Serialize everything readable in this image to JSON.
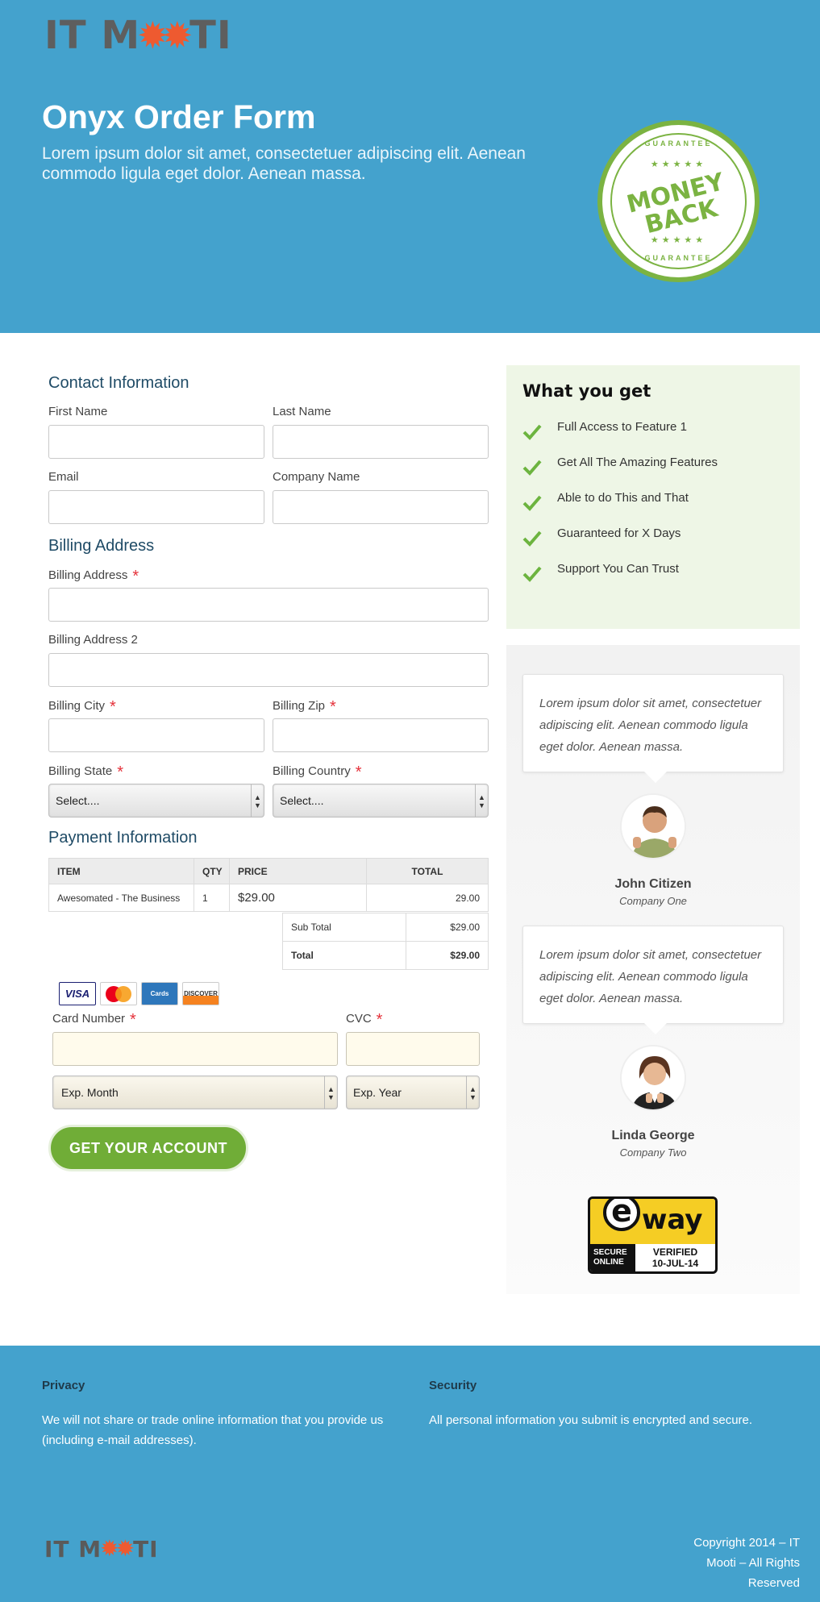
{
  "brand": {
    "logo_left": "IT M",
    "logo_right": "TI"
  },
  "hero": {
    "title": "Onyx Order Form",
    "lead": "Lorem ipsum dolor sit amet, consectetuer adipiscing elit. Aenean commodo ligula eget dolor. Aenean massa.",
    "seal": {
      "ring_top": "GUARANTEE",
      "ring_bottom": "GUARANTEE",
      "line1": "MONEY",
      "line2": "BACK",
      "stars": "★★★★★"
    }
  },
  "contact": {
    "title": "Contact Information",
    "first_name": "First Name",
    "last_name": "Last Name",
    "email": "Email",
    "company": "Company Name"
  },
  "billing": {
    "title": "Billing Address",
    "address": "Billing Address",
    "address2": "Billing Address 2",
    "city": "Billing City",
    "zip": "Billing Zip",
    "state": "Billing State",
    "country": "Billing Country",
    "state_value": "Select....",
    "country_value": "Select....",
    "required_mark": "*"
  },
  "payment": {
    "title": "Payment Information",
    "headers": [
      "ITEM",
      "QTY",
      "PRICE",
      "TOTAL"
    ],
    "row": {
      "item": "Awesomated - The Business",
      "qty": "1",
      "price": "$29.00",
      "total": "29.00"
    },
    "subtotal_label": "Sub Total",
    "subtotal": "$29.00",
    "total_label": "Total",
    "total": "$29.00",
    "cards": {
      "visa": "VISA",
      "mc": "MasterCard",
      "amex": "Cards",
      "discover": "DISCOVER"
    },
    "card_number": "Card Number",
    "cvc": "CVC",
    "exp_month": "Exp. Month",
    "exp_year": "Exp. Year",
    "submit": "GET YOUR ACCOUNT"
  },
  "benefits": {
    "title": "What you get",
    "items": [
      "Full Access to Feature 1",
      "Get All The Amazing Features",
      "Able to do This and That",
      "Guaranteed for X Days",
      "Support You Can Trust"
    ]
  },
  "testimonials": [
    {
      "quote": "Lorem ipsum dolor sit amet, consectetuer adipiscing elit. Aenean commodo ligula eget dolor. Aenean massa.",
      "name": "John Citizen",
      "company": "Company One"
    },
    {
      "quote": "Lorem ipsum dolor sit amet, consectetuer adipiscing elit. Aenean commodo ligula eget dolor. Aenean massa.",
      "name": "Linda George",
      "company": "Company Two"
    }
  ],
  "eway": {
    "brand": "way",
    "secure": "SECURE ONLINE",
    "verified": "VERIFIED",
    "date": "10-JUL-14"
  },
  "footer": {
    "privacy_title": "Privacy",
    "privacy_text": "We will not share or trade online information that you provide us (including e-mail addresses).",
    "security_title": "Security",
    "security_text": "All personal information you submit is encrypted and secure.",
    "copyright": "Copyright 2014 – IT Mooti – All Rights Reserved"
  },
  "colors": {
    "primary": "#44a2cd",
    "accent_green": "#70ad37",
    "gear_orange": "#ee5a30",
    "required_red": "#e5323b"
  }
}
